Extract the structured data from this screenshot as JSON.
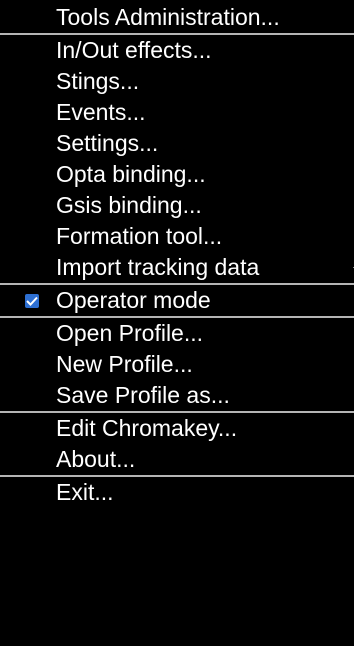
{
  "menu": {
    "items": [
      {
        "label": "Tools Administration...",
        "checked": false
      },
      {
        "label": "In/Out effects...",
        "checked": false
      },
      {
        "label": "Stings...",
        "checked": false
      },
      {
        "label": "Events...",
        "checked": false
      },
      {
        "label": "Settings...",
        "checked": false
      },
      {
        "label": "Opta binding...",
        "checked": false
      },
      {
        "label": "Gsis binding...",
        "checked": false
      },
      {
        "label": "Formation tool...",
        "checked": false
      },
      {
        "label": "Import tracking data",
        "checked": false
      },
      {
        "label": "Operator mode",
        "checked": true
      },
      {
        "label": "Open Profile...",
        "checked": false
      },
      {
        "label": "New Profile...",
        "checked": false
      },
      {
        "label": "Save Profile as...",
        "checked": false
      },
      {
        "label": "Edit Chromakey...",
        "checked": false
      },
      {
        "label": "About...",
        "checked": false
      },
      {
        "label": "Exit...",
        "checked": false
      }
    ],
    "colors": {
      "background": "#000000",
      "text": "#ffffff",
      "separator": "#c8c8c8",
      "check_accent": "#2d6fd2"
    }
  }
}
